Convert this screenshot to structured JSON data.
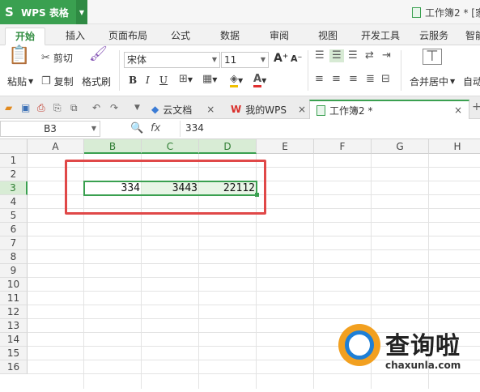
{
  "app": {
    "logo": "S",
    "name": "WPS 表格",
    "document_title": "工作簿2 * [家"
  },
  "ribbon_tabs": [
    "开始",
    "插入",
    "页面布局",
    "公式",
    "数据",
    "审阅",
    "视图",
    "开发工具",
    "云服务",
    "智能"
  ],
  "toolbar": {
    "paste": "粘贴",
    "cut": "剪切",
    "copy": "复制",
    "format_painter": "格式刷",
    "font_name": "宋体",
    "font_size": "11",
    "merge_center": "合并居中",
    "auto_wrap": "自动"
  },
  "doc_tabs": {
    "cloud_docs": "云文档",
    "my_wps": "我的WPS",
    "workbook": "工作簿2 *"
  },
  "formula_bar": {
    "name_box": "B3",
    "fx": "fx",
    "content": "334"
  },
  "grid": {
    "columns": [
      "A",
      "B",
      "C",
      "D",
      "E",
      "F",
      "G",
      "H"
    ],
    "selected_columns": [
      "B",
      "C",
      "D"
    ],
    "rows": [
      "1",
      "2",
      "3",
      "4",
      "5",
      "6",
      "7",
      "8",
      "9",
      "10",
      "11",
      "12",
      "13",
      "14",
      "15",
      "16"
    ],
    "selected_row": "3",
    "row3_values": {
      "B": "334",
      "C": "3443",
      "D": "22112"
    }
  },
  "watermark": {
    "text": "查询啦",
    "url": "chaxunla.com"
  },
  "colors": {
    "accent": "#3aa050",
    "highlight": "#e04848"
  }
}
